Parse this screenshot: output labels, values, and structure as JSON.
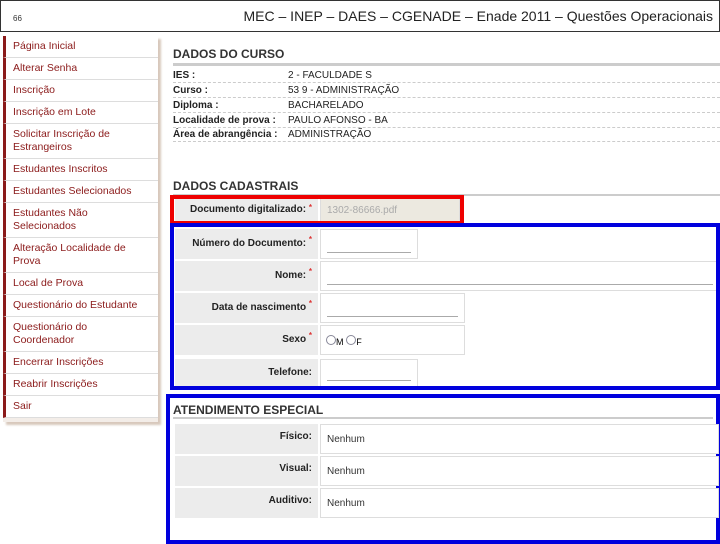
{
  "header": {
    "page_number": "66",
    "title": "MEC – INEP – DAES – CGENADE – Enade 2011 – Questões Operacionais"
  },
  "sidebar": {
    "items": [
      "Página Inicial",
      "Alterar Senha",
      "Inscrição",
      "Inscrição em Lote",
      "Solicitar Inscrição de Estrangeiros",
      "Estudantes Inscritos",
      "Estudantes Selecionados",
      "Estudantes Não Selecionados",
      "Alteração Localidade de Prova",
      "Local de Prova",
      "Questionário do Estudante",
      "Questionário do Coordenador",
      "Encerrar Inscrições",
      "Reabrir Inscrições",
      "Sair"
    ]
  },
  "curso": {
    "heading": "DADOS DO CURSO",
    "rows": [
      {
        "label": "IES :",
        "value": "2 - FACULDADE S"
      },
      {
        "label": "Curso :",
        "value": "53  9 - ADMINISTRAÇÃO"
      },
      {
        "label": "Diploma :",
        "value": "BACHARELADO"
      },
      {
        "label": "Localidade de prova :",
        "value": "PAULO AFONSO - BA"
      },
      {
        "label": "Área de abrangência :",
        "value": "ADMINISTRAÇÃO"
      }
    ]
  },
  "cadastrais": {
    "heading": "DADOS CADASTRAIS",
    "required": "*",
    "documento_label": "Documento digitalizado:",
    "documento_value": "1302-86666.pdf",
    "numero_label": "Número do Documento:",
    "nome_label": "Nome:",
    "nascimento_label": "Data de nascimento",
    "sexo_label": "Sexo",
    "sexo_m": "M",
    "sexo_f": "F",
    "telefone_label": "Telefone:"
  },
  "atendimento": {
    "heading": "ATENDIMENTO ESPECIAL",
    "rows": [
      {
        "label": "Físico:",
        "value": "Nenhum"
      },
      {
        "label": "Visual:",
        "value": "Nenhum"
      },
      {
        "label": "Auditivo:",
        "value": "Nenhum"
      }
    ]
  }
}
